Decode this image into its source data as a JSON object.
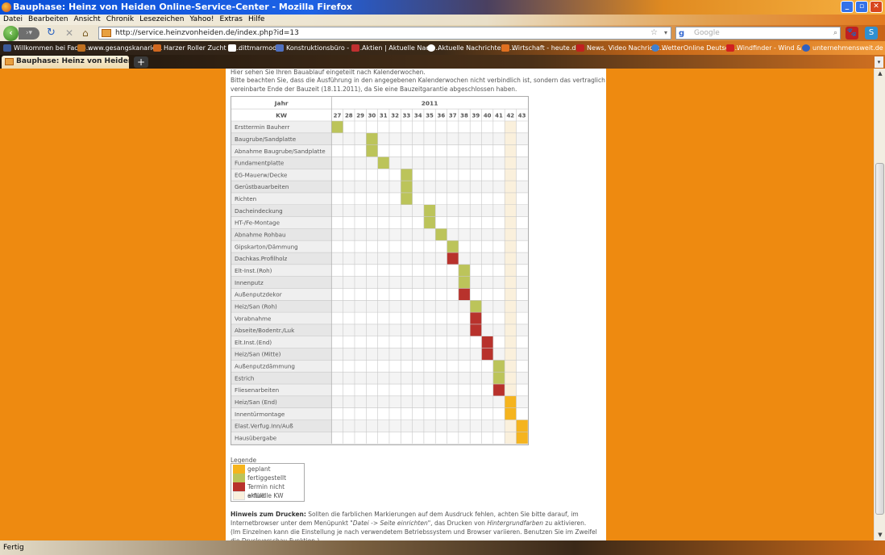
{
  "window": {
    "title": "Bauphase: Heinz von Heiden Online-Service-Center - Mozilla Firefox"
  },
  "menu": [
    "Datei",
    "Bearbeiten",
    "Ansicht",
    "Chronik",
    "Lesezeichen",
    "Yahoo!",
    "Extras",
    "Hilfe"
  ],
  "nav": {
    "url": "http://service.heinzvonheiden.de/index.php?id=13",
    "search_placeholder": "Google",
    "back_icon": "back-arrow-icon",
    "forward_icon": "forward-arrow-icon",
    "reload_icon": "reload-icon",
    "stop_icon": "stop-icon",
    "home_icon": "home-icon"
  },
  "bookmarks": [
    {
      "label": "Willkommen bei Faceb...",
      "color": "#3b5998"
    },
    {
      "label": "www.gesangskanarie...",
      "color": "#c07020"
    },
    {
      "label": "Harzer Roller Zucht in ...",
      "color": "#d06820"
    },
    {
      "label": "dittmarmodell",
      "color": "#ffffff"
    },
    {
      "label": "Konstruktionsbüro - w...",
      "color": "#5070c0"
    },
    {
      "label": "Aktien | Aktuelle Nach...",
      "color": "#c03030"
    },
    {
      "label": "Aktuelle Nachrichten -...",
      "color": "#ffffff"
    },
    {
      "label": "Wirtschaft - heute.de",
      "color": "#e07020"
    },
    {
      "label": "News, Video Nachricht...",
      "color": "#c02020"
    },
    {
      "label": "WetterOnline Deutsch...",
      "color": "#4080d0"
    },
    {
      "label": "Windfinder - Wind & ...",
      "color": "#d02020"
    },
    {
      "label": "unternehmensweit.de",
      "color": "#3060c0"
    }
  ],
  "tab": {
    "title": "Bauphase: Heinz von Heiden Online-"
  },
  "page": {
    "intro1": "Hier sehen Sie Ihren Bauablauf eingeteilt nach Kalenderwochen.",
    "intro2": "Bitte beachten Sie, dass die Ausführung in den angegebenen Kalenderwochen nicht verbindlich ist, sondern das vertraglich",
    "intro3": "vereinbarte Ende der Bauzeit (18.11.2011), da Sie eine Bauzeitgarantie abgeschlossen haben.",
    "legend_title": "Legende",
    "hint_label": "Hinweis zum Drucken:",
    "hint_p1": " Sollten die farblichen Markierungen auf dem Ausdruck fehlen, achten Sie bitte darauf, im Internetbrowser unter dem Menüpunkt ",
    "hint_menu": "\"Datei -> Seite einrichten\"",
    "hint_p2": ", das Drucken von ",
    "hint_bg": "Hintergrundfarben",
    "hint_p3": " zu aktivieren. (Im Einzelnen kann die Einstellung je nach verwendetem Betriebssystem und Browser variieren. Benutzen Sie im Zweifel die Druckvorschau-Funktion.)"
  },
  "legend": [
    {
      "key": "geplant",
      "label": "geplant",
      "color": "#f5b41e"
    },
    {
      "key": "fertig",
      "label": "fertiggestellt",
      "color": "#bcc45a"
    },
    {
      "key": "nicht",
      "label": "Termin nicht erfüllt",
      "color": "#b8322c"
    },
    {
      "key": "aktuell",
      "label": "aktuelle KW",
      "color": "#faf0dc"
    }
  ],
  "chart_data": {
    "type": "table",
    "year_header": "Jahr",
    "year": "2011",
    "kw_header": "KW",
    "weeks": [
      27,
      28,
      29,
      30,
      31,
      32,
      33,
      34,
      35,
      36,
      37,
      38,
      39,
      40,
      41,
      42,
      43
    ],
    "current_week": 42,
    "tasks": [
      {
        "name": "Ersttermin Bauherr",
        "cells": [
          {
            "week": 27,
            "status": "fertig"
          }
        ]
      },
      {
        "name": "Baugrube/Sandplatte",
        "cells": [
          {
            "week": 30,
            "status": "fertig"
          }
        ]
      },
      {
        "name": "Abnahme Baugrube/Sandplatte",
        "cells": [
          {
            "week": 30,
            "status": "fertig"
          }
        ]
      },
      {
        "name": "Fundamentplatte",
        "cells": [
          {
            "week": 31,
            "status": "fertig"
          }
        ]
      },
      {
        "name": "EG-Mauerw/Decke",
        "cells": [
          {
            "week": 33,
            "status": "fertig"
          }
        ]
      },
      {
        "name": "Gerüstbauarbeiten",
        "cells": [
          {
            "week": 33,
            "status": "fertig"
          }
        ]
      },
      {
        "name": "Richten",
        "cells": [
          {
            "week": 33,
            "status": "fertig"
          }
        ]
      },
      {
        "name": "Dacheindeckung",
        "cells": [
          {
            "week": 35,
            "status": "fertig"
          }
        ]
      },
      {
        "name": "HT-/Fe-Montage",
        "cells": [
          {
            "week": 35,
            "status": "fertig"
          }
        ]
      },
      {
        "name": "Abnahme Rohbau",
        "cells": [
          {
            "week": 36,
            "status": "fertig"
          }
        ]
      },
      {
        "name": "Gipskarton/Dämmung",
        "cells": [
          {
            "week": 37,
            "status": "fertig"
          }
        ]
      },
      {
        "name": "Dachkas.Profilholz",
        "cells": [
          {
            "week": 37,
            "status": "nicht"
          }
        ]
      },
      {
        "name": "Elt-Inst.(Roh)",
        "cells": [
          {
            "week": 38,
            "status": "fertig"
          }
        ]
      },
      {
        "name": "Innenputz",
        "cells": [
          {
            "week": 38,
            "status": "fertig"
          }
        ]
      },
      {
        "name": "Außenputzdekor",
        "cells": [
          {
            "week": 38,
            "status": "nicht"
          }
        ]
      },
      {
        "name": "Heiz/San (Roh)",
        "cells": [
          {
            "week": 39,
            "status": "fertig"
          }
        ]
      },
      {
        "name": "Vorabnahme",
        "cells": [
          {
            "week": 39,
            "status": "nicht"
          }
        ]
      },
      {
        "name": "Abseite/Bodentr./Luk",
        "cells": [
          {
            "week": 39,
            "status": "nicht"
          }
        ]
      },
      {
        "name": "Elt.Inst.(End)",
        "cells": [
          {
            "week": 40,
            "status": "nicht"
          }
        ]
      },
      {
        "name": "Heiz/San (Mitte)",
        "cells": [
          {
            "week": 40,
            "status": "nicht"
          }
        ]
      },
      {
        "name": "Außenputzdämmung",
        "cells": [
          {
            "week": 41,
            "status": "fertig"
          }
        ]
      },
      {
        "name": "Estrich",
        "cells": [
          {
            "week": 41,
            "status": "fertig"
          }
        ]
      },
      {
        "name": "Fliesenarbeiten",
        "cells": [
          {
            "week": 41,
            "status": "nicht"
          }
        ]
      },
      {
        "name": "Heiz/San (End)",
        "cells": [
          {
            "week": 42,
            "status": "geplant"
          }
        ]
      },
      {
        "name": "Innentürmontage",
        "cells": [
          {
            "week": 42,
            "status": "geplant"
          }
        ]
      },
      {
        "name": "Elast.Verfug.Inn/Auß",
        "cells": [
          {
            "week": 43,
            "status": "geplant"
          }
        ]
      },
      {
        "name": "Hausübergabe",
        "cells": [
          {
            "week": 43,
            "status": "geplant"
          }
        ]
      }
    ]
  },
  "status": {
    "text": "Fertig"
  }
}
